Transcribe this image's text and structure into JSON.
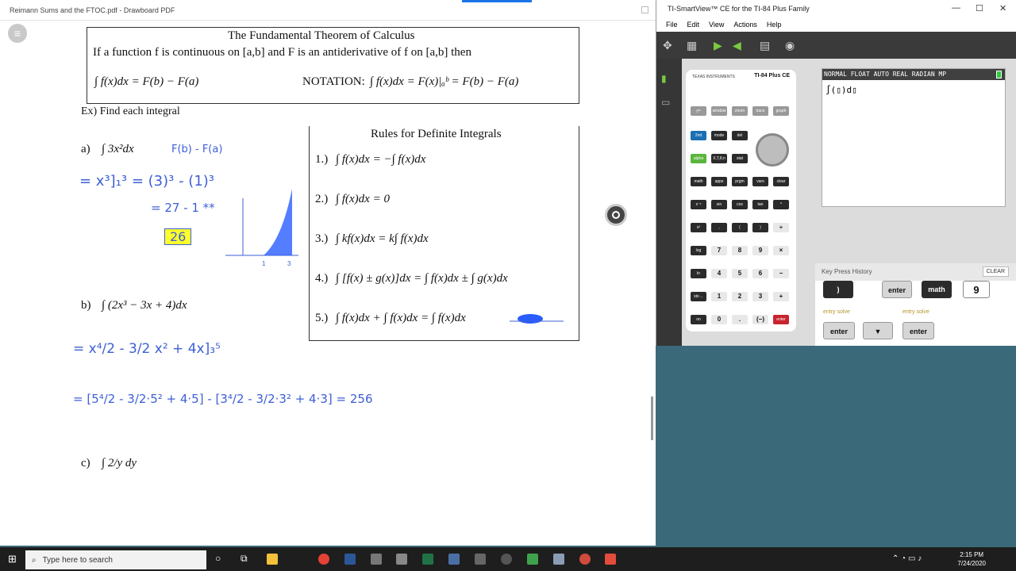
{
  "drawboard": {
    "title": "Reimann Sums and the FTOC.pdf - Drawboard PDF"
  },
  "doc": {
    "heading": "The Fundamental Theorem of Calculus",
    "statement": "If a function f is continuous on [a,b] and F is an antiderivative of f on [a,b] then",
    "ftoc": "∫ f(x)dx = F(b) − F(a)",
    "notation_label": "NOTATION:",
    "notation": "∫ f(x)dx = F(x)|ₐᵇ = F(b) − F(a)",
    "ex_label": "Ex) Find each integral",
    "rules_title": "Rules for Definite Integrals",
    "rules": [
      {
        "n": "1.)",
        "text": "∫ f(x)dx = −∫ f(x)dx",
        "lo": "b",
        "hi": "a",
        "lo2": "a",
        "hi2": "b"
      },
      {
        "n": "2.)",
        "text": "∫ f(x)dx = 0",
        "lo": "a",
        "hi": "a"
      },
      {
        "n": "3.)",
        "text": "∫ kf(x)dx = k∫ f(x)dx",
        "lo": "a",
        "hi": "b",
        "lo2": "a",
        "hi2": "b"
      },
      {
        "n": "4.)",
        "text": "∫ [f(x) ± g(x)]dx = ∫ f(x)dx ± ∫ g(x)dx",
        "lo": "a",
        "hi": "b"
      },
      {
        "n": "5.)",
        "text": "∫ f(x)dx + ∫ f(x)dx = ∫ f(x)dx",
        "lo": "a",
        "hi": "b",
        "lo2": "b",
        "hi2": "c"
      }
    ],
    "problems": [
      {
        "label": "a)",
        "expr": "∫ 3x²dx",
        "lo": "1",
        "hi": "3"
      },
      {
        "label": "b)",
        "expr": "∫ (2x³ − 3x + 4)dx",
        "lo": "3",
        "hi": "5"
      },
      {
        "label": "c)",
        "expr": "∫ 2/y dy",
        "lo": "1",
        "hi": "3"
      }
    ],
    "handwriting": {
      "a_note": "F(b) - F(a)",
      "a_line1": "= x³]₁³ = (3)³ - (1)³",
      "a_line2": "= 27 - 1 **",
      "a_answer": "26",
      "b_line1": "= x⁴/2 - 3/2 x² + 4x]₃⁵",
      "b_line2": "= [5⁴/2 - 3/2·5² + 4·5] - [3⁴/2 - 3/2·3² + 4·3] = 256",
      "graph_labels": [
        "1",
        "3"
      ]
    }
  },
  "ti": {
    "title": "TI-SmartView™ CE for the TI-84 Plus Family",
    "menu": [
      "File",
      "Edit",
      "View",
      "Actions",
      "Help"
    ],
    "brand": "TEXAS INSTRUMENTS",
    "model": "TI-84 Plus CE",
    "status": "NORMAL FLOAT AUTO REAL RADIAN MP",
    "screen": "∫(▯)d▯",
    "key_history_label": "Key Press History",
    "clear": "CLEAR",
    "history_row1": [
      ")",
      "enter",
      "math",
      "9"
    ],
    "history_row2": [
      "enter",
      "▼",
      "enter"
    ],
    "history_sub": [
      "entry solve",
      "entry solve"
    ],
    "keys": [
      [
        "y=",
        "window",
        "zoom",
        "trace",
        "graph"
      ],
      [
        "2nd",
        "mode",
        "del"
      ],
      [
        "alpha",
        "X,T,θ,n",
        "stat"
      ],
      [
        "math",
        "apps",
        "prgm",
        "vars",
        "clear"
      ],
      [
        "x⁻¹",
        "sin",
        "cos",
        "tan",
        "^"
      ],
      [
        "x²",
        ",",
        "(",
        ")",
        "÷"
      ],
      [
        "log",
        "7",
        "8",
        "9",
        "×"
      ],
      [
        "ln",
        "4",
        "5",
        "6",
        "−"
      ],
      [
        "sto→",
        "1",
        "2",
        "3",
        "+"
      ],
      [
        "on",
        "0",
        ".",
        "(−)",
        "enter"
      ]
    ]
  },
  "taskbar": {
    "search": "Type here to search",
    "time": "2:15 PM",
    "date": "7/24/2020"
  }
}
